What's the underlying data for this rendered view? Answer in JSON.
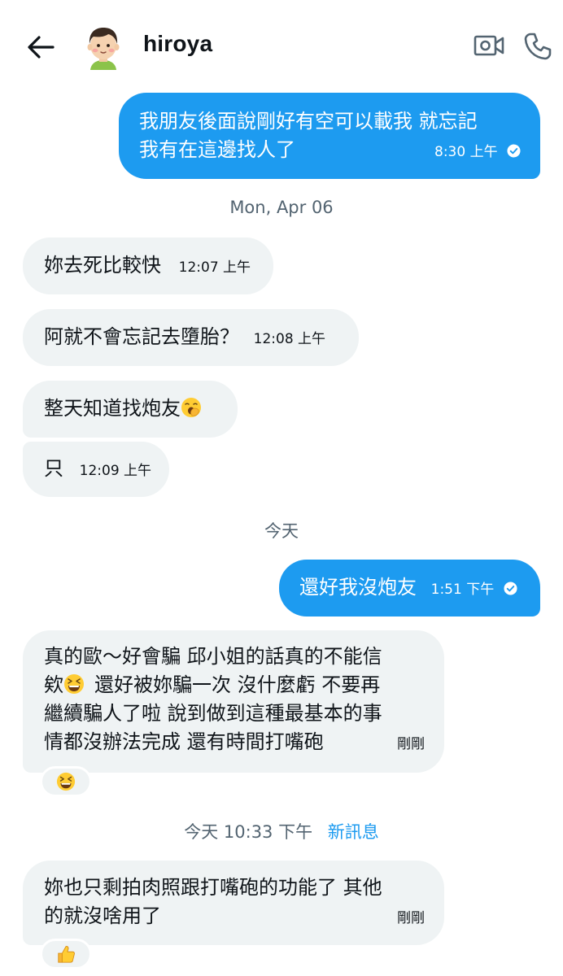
{
  "header": {
    "contact_name": "hiroya"
  },
  "messages": [
    {
      "id": "m1",
      "direction": "outgoing",
      "lines": [
        "我朋友後面說剛好有空可以載我 就忘記",
        "我有在這邊找人了"
      ],
      "time": "8:30 上午",
      "status": "read"
    },
    {
      "id": "sep1",
      "type": "date",
      "label": "Mon, Apr 06"
    },
    {
      "id": "m2",
      "direction": "incoming",
      "text": "妳去死比較快",
      "time": "12:07 上午"
    },
    {
      "id": "m3",
      "direction": "incoming",
      "text": "阿就不會忘記去墮胎？",
      "time": "12:08 上午"
    },
    {
      "id": "m4",
      "direction": "incoming",
      "text": "整天知道找炮友",
      "emoji": "yawning-face"
    },
    {
      "id": "m5",
      "direction": "incoming",
      "text": "只",
      "time": "12:09 上午"
    },
    {
      "id": "sep2",
      "type": "date",
      "label": "今天"
    },
    {
      "id": "m6",
      "direction": "outgoing",
      "text": "還好我沒炮友",
      "time": "1:51 下午",
      "status": "read"
    },
    {
      "id": "m7",
      "direction": "incoming",
      "lines": [
        "真的歐～好會騙 邱小姐的話真的不能信",
        "欸",
        "還好被妳騙一次 沒什麼虧 不要再",
        "繼續騙人了啦 說到做到這種最基本的事",
        "情都沒辦法完成 還有時間打嘴砲"
      ],
      "inline_emoji": "grinning-squinting-face",
      "time": "剛剛",
      "reaction": "grinning-squinting-face"
    },
    {
      "id": "sep3",
      "type": "date",
      "label": "今天 10:33 下午",
      "badge": "新訊息"
    },
    {
      "id": "m8",
      "direction": "incoming",
      "lines": [
        "妳也只剩拍肉照跟打嘴砲的功能了 其他",
        "的就沒啥用了"
      ],
      "time": "剛剛",
      "reaction": "thumbs-up"
    }
  ],
  "colors": {
    "accent": "#1d9bf0",
    "incoming_bubble": "#eff3f4",
    "secondary_text": "#536471",
    "primary_text": "#0f1419"
  }
}
